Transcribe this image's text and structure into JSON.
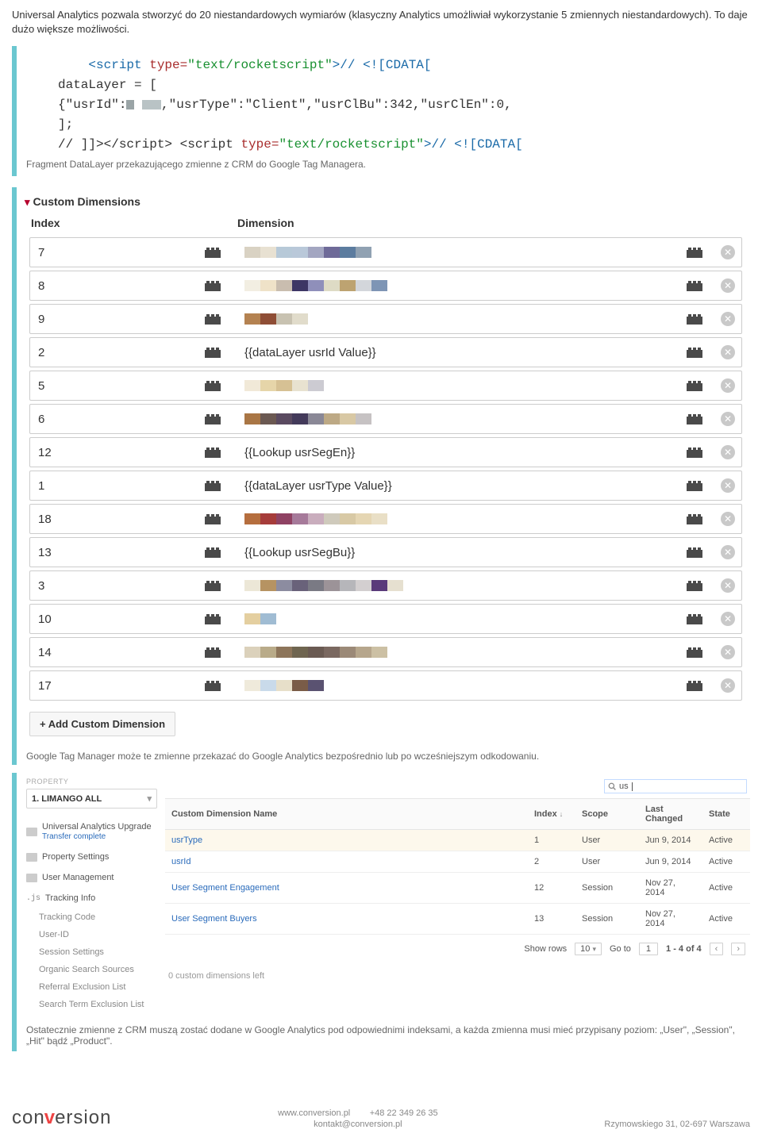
{
  "intro": "Universal Analytics pozwala stworzyć do 20 niestandardowych wymiarów (klasyczny Analytics umożliwiał wykorzystanie 5 zmiennych niestandardowych). To daje dużo większe możliwości.",
  "code": {
    "line1_a": "<script ",
    "line1_b": "type=",
    "line1_c": "\"text/rocketscript\"",
    "line1_d": ">// <![CDATA[",
    "line2": "dataLayer = [",
    "line3_a": "{\"usrId\":",
    "line3_b": ",\"usrType\":\"Client\",\"usrClBu\":342,\"usrClEn\":0,",
    "line4": "];",
    "line5_a": "// ]]></script> <script ",
    "line5_b": "type=",
    "line5_c": "\"text/rocketscript\"",
    "line5_d": ">// <![CDATA["
  },
  "caption_datalayer": "Fragment DataLayer przekazującego zmienne z CRM do Google Tag Managera.",
  "cd": {
    "title": "Custom Dimensions",
    "head_index": "Index",
    "head_dim": "Dimension",
    "rows": [
      {
        "index": "7",
        "text": "",
        "swatches": [
          "#d9d2c3",
          "#e8e1d2",
          "#b7c9d8",
          "#b9c8d9",
          "#a3a6c1",
          "#6e6a98",
          "#5c7c9f",
          "#90a1b2"
        ]
      },
      {
        "index": "8",
        "text": "",
        "swatches": [
          "#f2eee2",
          "#efe2c8",
          "#c9bdaf",
          "#3d3665",
          "#8f8fba",
          "#dedbc5",
          "#bda371",
          "#d3d6db",
          "#7e95b5"
        ]
      },
      {
        "index": "9",
        "text": "",
        "swatches": [
          "#b48251",
          "#8f4e36",
          "#c8c2b1",
          "#e1dccb"
        ]
      },
      {
        "index": "2",
        "text": "{{dataLayer usrId Value}}",
        "swatches": []
      },
      {
        "index": "5",
        "text": "",
        "swatches": [
          "#f1e9d8",
          "#e6d5a9",
          "#d6c194",
          "#e8e2d0",
          "#cccbd2"
        ]
      },
      {
        "index": "6",
        "text": "",
        "swatches": [
          "#a97645",
          "#6b5952",
          "#5a4a60",
          "#433a5a",
          "#8a8896",
          "#bda985",
          "#d8c8a4",
          "#c6c2c3"
        ]
      },
      {
        "index": "12",
        "text": "{{Lookup usrSegEn}}",
        "swatches": []
      },
      {
        "index": "1",
        "text": "{{dataLayer usrType Value}}",
        "swatches": []
      },
      {
        "index": "18",
        "text": "",
        "swatches": [
          "#b56e3e",
          "#a63c3a",
          "#8f4263",
          "#a67a9a",
          "#c9adbd",
          "#cfcabc",
          "#d8c9a5",
          "#e5d6b3",
          "#e9dfc6"
        ]
      },
      {
        "index": "13",
        "text": "{{Lookup usrSegBu}}",
        "swatches": []
      },
      {
        "index": "3",
        "text": "",
        "swatches": [
          "#ece7d7",
          "#b69362",
          "#8c8ca0",
          "#69627a",
          "#7a7a84",
          "#9c9398",
          "#b6b6ba",
          "#d3cfd0",
          "#5a3a7a",
          "#e6e0d0"
        ]
      },
      {
        "index": "10",
        "text": "",
        "swatches": [
          "#e4cfa0",
          "#a0bcd3"
        ]
      },
      {
        "index": "14",
        "text": "",
        "swatches": [
          "#dbd1bb",
          "#b9ab89",
          "#8d755a",
          "#6f6550",
          "#6a5a52",
          "#7a6860",
          "#9b8977",
          "#b6a68c",
          "#ccc0a4"
        ]
      },
      {
        "index": "17",
        "text": "",
        "swatches": [
          "#efeadb",
          "#c9daea",
          "#e7dfc9",
          "#7a5c48",
          "#5a5271"
        ]
      }
    ],
    "add": "+ Add Custom Dimension"
  },
  "caption_gtm": "Google Tag Manager może te zmienne przekazać do Google Analytics bezpośrednio lub po wcześniejszym odkodowaniu.",
  "ga": {
    "property_label": "PROPERTY",
    "property_value": "1. LIMANGO ALL",
    "nav": {
      "upgrade": "Universal Analytics Upgrade",
      "transfer": "Transfer complete",
      "prop": "Property Settings",
      "user": "User Management",
      "tracking": "Tracking Info",
      "subs": [
        "Tracking Code",
        "User-ID",
        "Session Settings",
        "Organic Search Sources",
        "Referral Exclusion List",
        "Search Term Exclusion List"
      ]
    },
    "search_value": "us",
    "cols": {
      "name": "Custom Dimension Name",
      "index": "Index",
      "scope": "Scope",
      "changed": "Last Changed",
      "state": "State"
    },
    "rows": [
      {
        "name": "usrType",
        "index": "1",
        "scope": "User",
        "changed": "Jun 9, 2014",
        "state": "Active"
      },
      {
        "name": "usrId",
        "index": "2",
        "scope": "User",
        "changed": "Jun 9, 2014",
        "state": "Active"
      },
      {
        "name": "User Segment Engagement",
        "index": "12",
        "scope": "Session",
        "changed": "Nov 27, 2014",
        "state": "Active"
      },
      {
        "name": "User Segment Buyers",
        "index": "13",
        "scope": "Session",
        "changed": "Nov 27, 2014",
        "state": "Active"
      }
    ],
    "pager": {
      "show": "Show rows",
      "rows": "10",
      "goto": "Go to",
      "page": "1",
      "range": "1 - 4 of 4"
    },
    "left_note": "0 custom dimensions left"
  },
  "caption_ga": "Ostatecznie zmienne z CRM muszą zostać dodane w Google Analytics pod odpowiednimi indeksami, a każda zmienna musi mieć przypisany poziom: „User\", „Session\", „Hit\" bądź „Product\".",
  "footer": {
    "brand_a": "con",
    "brand_v": "v",
    "brand_b": "ersion",
    "site": "www.conversion.pl",
    "phone": "+48 22 349 26 35",
    "email": "kontakt@conversion.pl",
    "address": "Rzymowskiego 31, 02-697 Warszawa"
  }
}
